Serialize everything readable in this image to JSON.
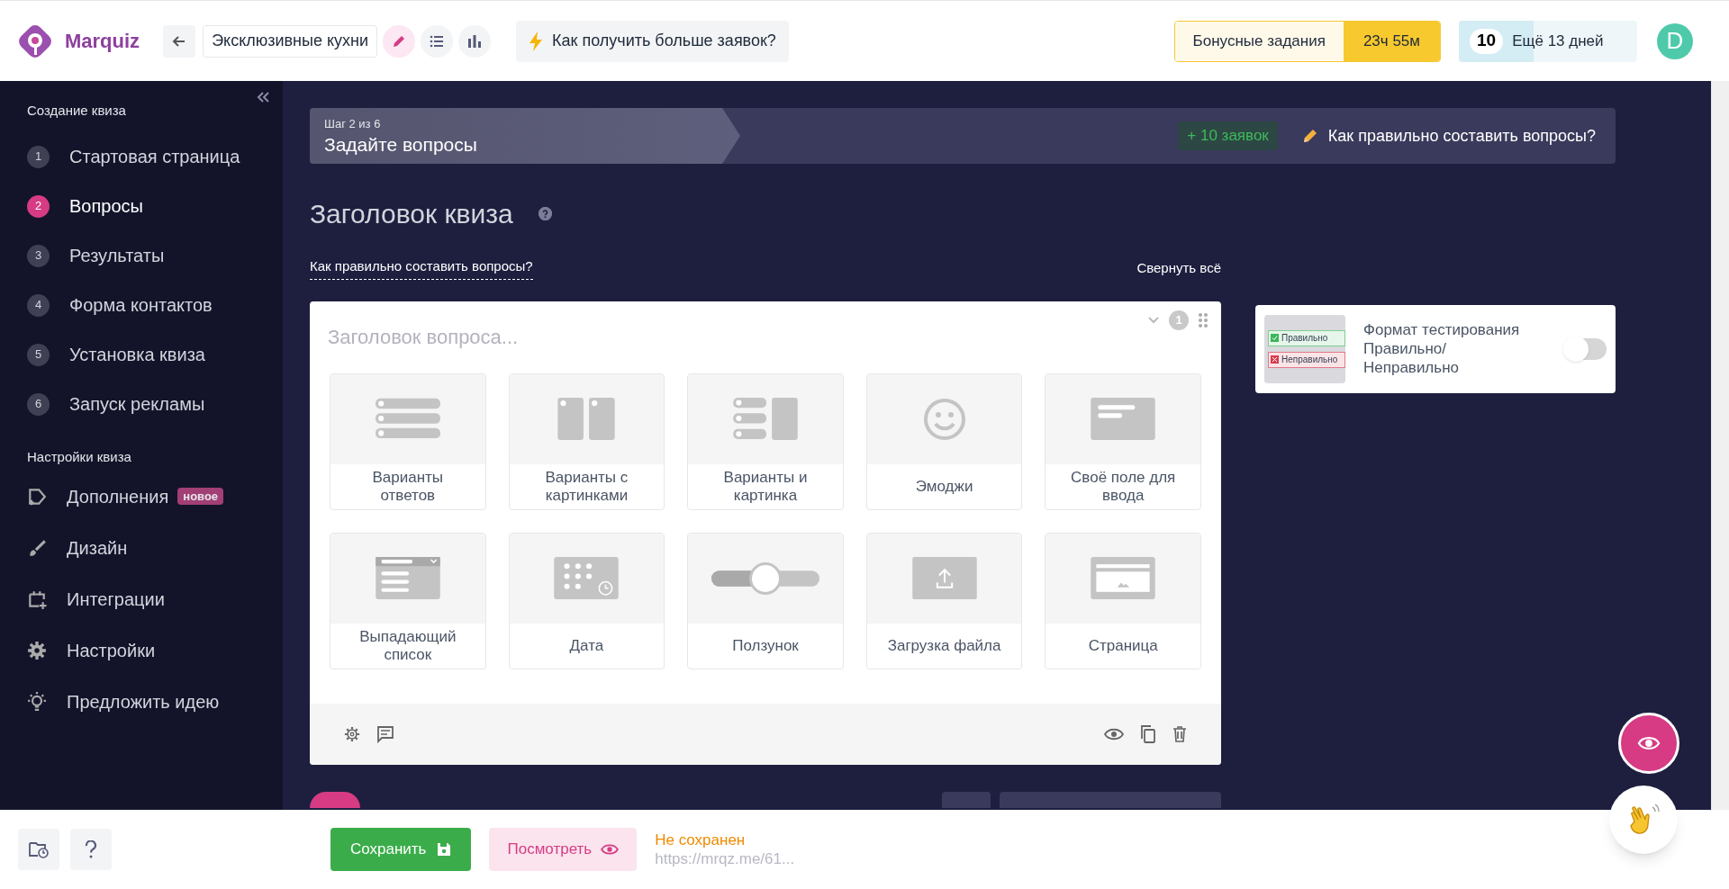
{
  "header": {
    "logo_text": "Marquiz",
    "quiz_name": "Эксклюзивные кухни",
    "tools": [
      {
        "kind": "edit",
        "selected": true
      },
      {
        "kind": "list",
        "selected": false
      },
      {
        "kind": "stats",
        "selected": false
      }
    ],
    "tip": "Как получить больше заявок?",
    "bonus": {
      "label": "Бонусные задания",
      "timer": "23ч 55м"
    },
    "trial": {
      "count": "10",
      "text": "Ещё 13 дней",
      "level": 0.42
    },
    "avatar": "D"
  },
  "sidebar": {
    "sections": [
      {
        "title": "Создание квиза",
        "items": [
          {
            "number": "1",
            "label": "Стартовая страница",
            "selected": false
          },
          {
            "number": "2",
            "label": "Вопросы",
            "selected": true
          },
          {
            "number": "3",
            "label": "Результаты",
            "selected": false
          },
          {
            "number": "4",
            "label": "Форма контактов",
            "selected": false
          },
          {
            "number": "5",
            "label": "Установка квиза",
            "selected": false
          },
          {
            "number": "6",
            "label": "Запуск рекламы",
            "selected": false
          }
        ]
      },
      {
        "title": "Настройки квиза",
        "items": [
          {
            "kind": "tag",
            "label": "Дополнения",
            "badge": "новое",
            "selected": false
          },
          {
            "kind": "brush",
            "label": "Дизайн",
            "selected": false
          },
          {
            "kind": "integration",
            "label": "Интеграции",
            "selected": false
          },
          {
            "kind": "gear",
            "label": "Настройки",
            "selected": false
          },
          {
            "kind": "bulb",
            "label": "Предложить идею",
            "selected": false
          }
        ]
      }
    ]
  },
  "step": {
    "step_label": "Шаг 2 из 6",
    "title": "Задайте вопросы",
    "reward": "+ 10 заявок",
    "help": "Как правильно составить вопросы?"
  },
  "quiz_title": "Заголовок квиза",
  "help_link": "Как правильно составить вопросы?",
  "collapse_all": "Свернуть всё",
  "question": {
    "placeholder": "Заголовок вопроса...",
    "number": "1",
    "types": [
      {
        "kind": "options",
        "label": "Варианты ответов"
      },
      {
        "kind": "image_options",
        "label": "Варианты с картинками"
      },
      {
        "kind": "options_image",
        "label": "Варианты и картинка"
      },
      {
        "kind": "emoji",
        "label": "Эмоджи"
      },
      {
        "kind": "input",
        "label": "Своё поле для ввода"
      },
      {
        "kind": "dropdown",
        "label": "Выпадающий список"
      },
      {
        "kind": "date",
        "label": "Дата"
      },
      {
        "kind": "slider",
        "label": "Ползунок"
      },
      {
        "kind": "upload",
        "label": "Загрузка файла"
      },
      {
        "kind": "page",
        "label": "Страница"
      }
    ]
  },
  "testing_format": {
    "label": "Формат тестирования Правильно/ Неправильно",
    "on": false,
    "preview": [
      "Правильно",
      "Неправильно"
    ]
  },
  "footer": {
    "save": "Сохранить",
    "preview": "Посмотреть",
    "status": "Не сохранен",
    "url": "https://mrqz.me/61..."
  }
}
